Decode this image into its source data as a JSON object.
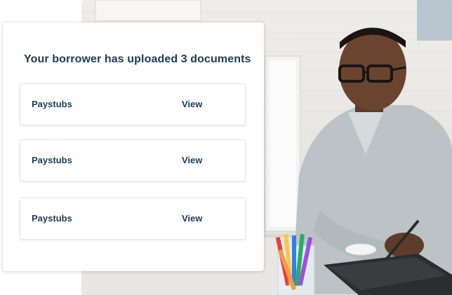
{
  "card": {
    "title": "Your borrower has uploaded 3 documents",
    "documents": [
      {
        "name": "Paystubs",
        "action": "View"
      },
      {
        "name": "Paystubs",
        "action": "View"
      },
      {
        "name": "Paystubs",
        "action": "View"
      }
    ]
  },
  "colors": {
    "text_primary": "#1c3a57",
    "card_background": "#ffffff",
    "row_border": "#e1e4e8"
  }
}
